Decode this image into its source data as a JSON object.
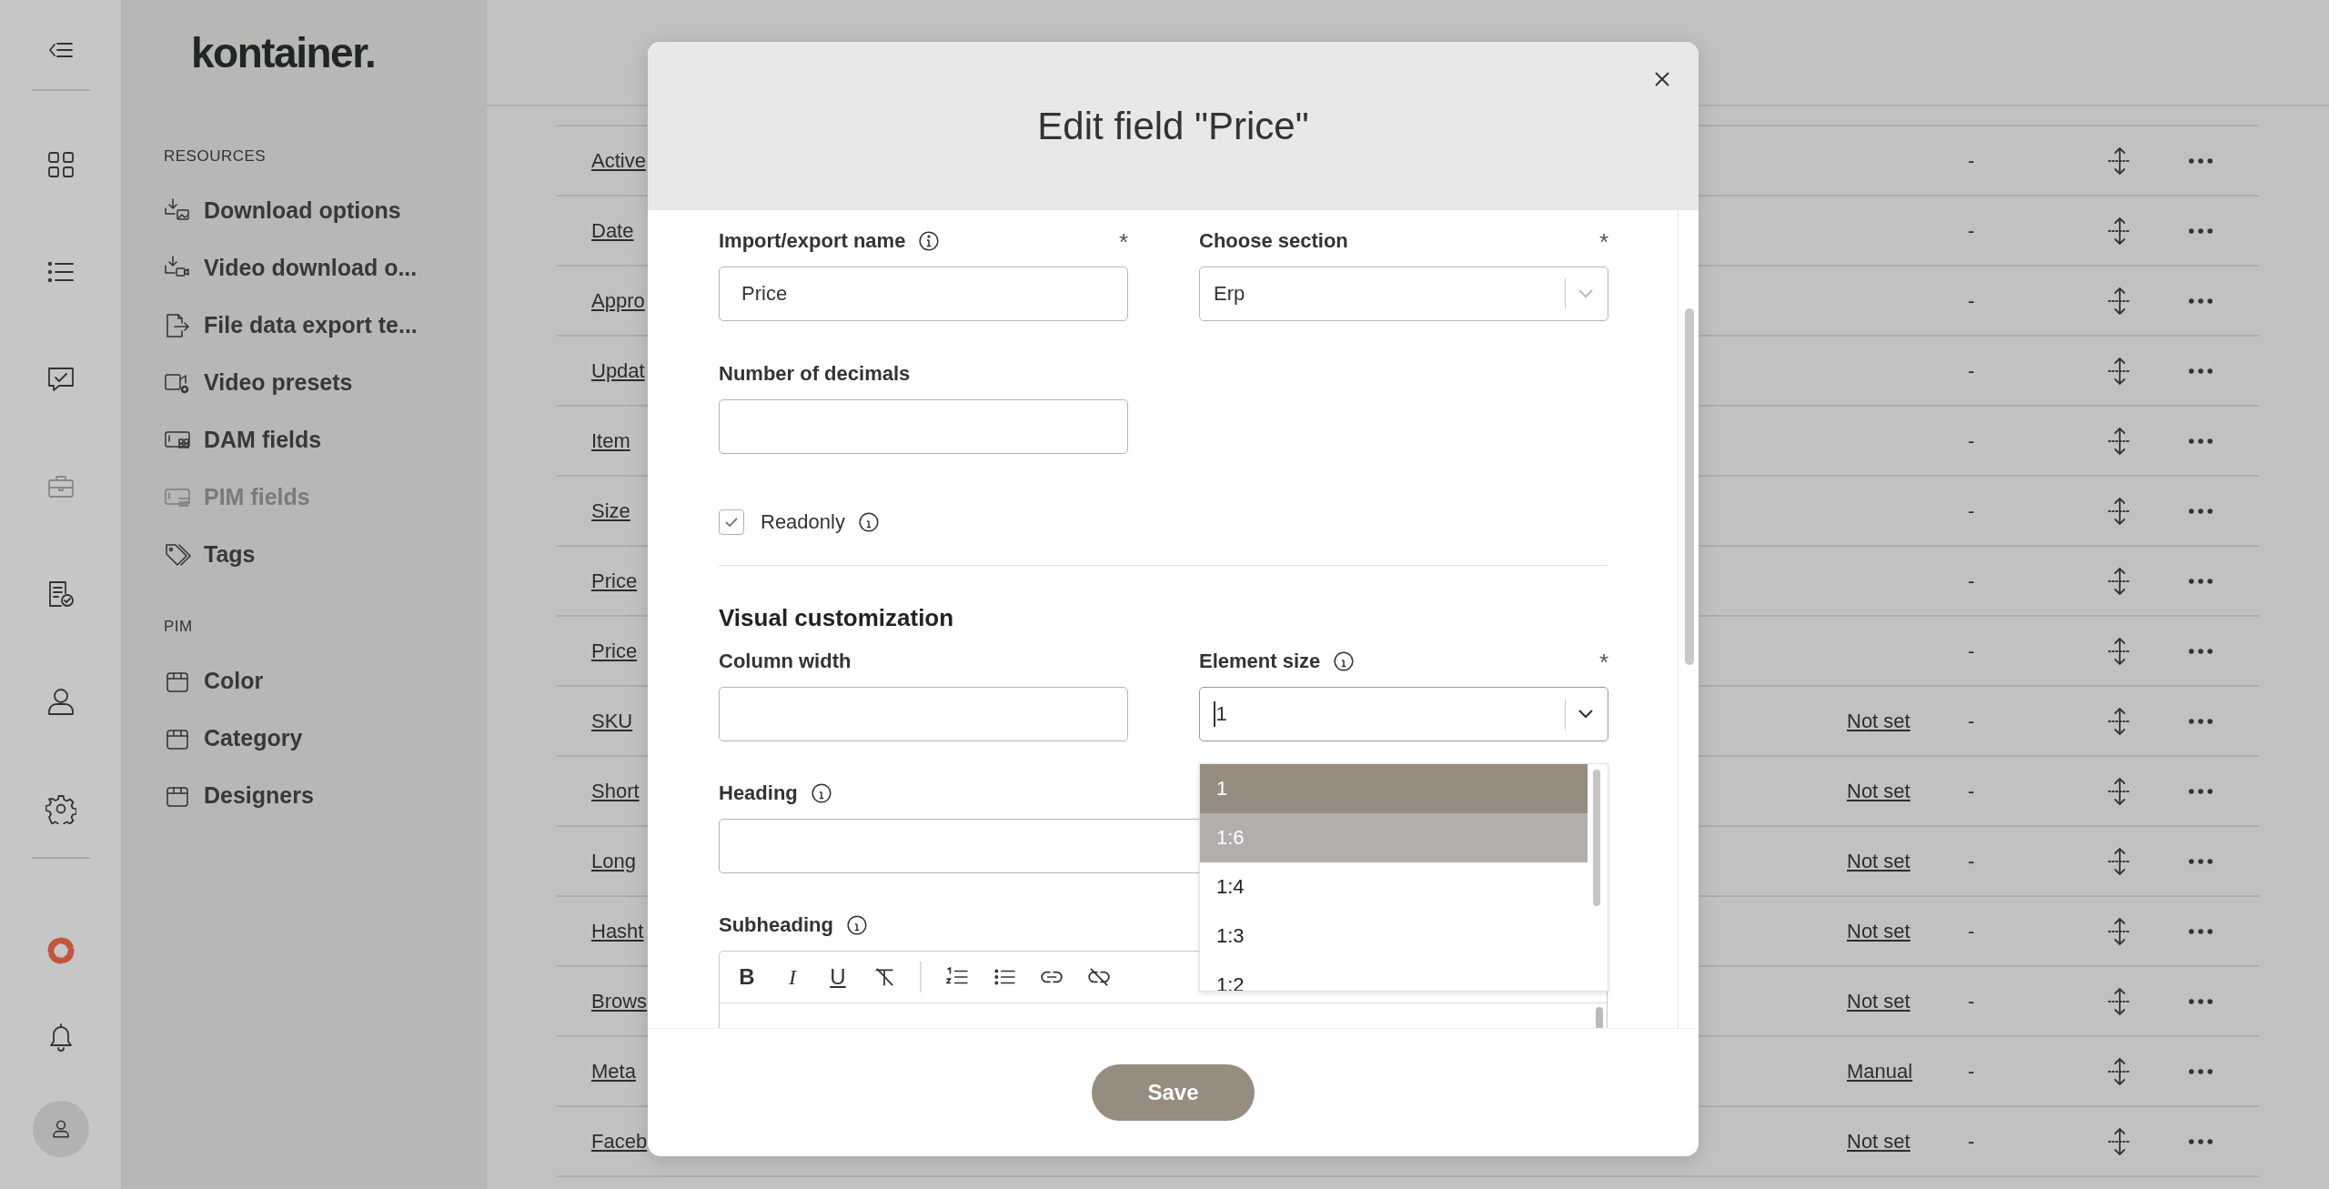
{
  "sidebar": {
    "logo": "kontainer.",
    "sections": [
      {
        "heading": "RESOURCES",
        "items": [
          {
            "label": "Download options",
            "selected": false
          },
          {
            "label": "Video download o...",
            "selected": false
          },
          {
            "label": "File data export te...",
            "selected": false
          },
          {
            "label": "Video presets",
            "selected": false
          },
          {
            "label": "DAM fields",
            "selected": false
          },
          {
            "label": "PIM fields",
            "selected": true
          },
          {
            "label": "Tags",
            "selected": false
          }
        ]
      },
      {
        "heading": "PIM",
        "items": [
          {
            "label": "Color",
            "selected": false
          },
          {
            "label": "Category",
            "selected": false
          },
          {
            "label": "Designers",
            "selected": false
          }
        ]
      }
    ]
  },
  "table": {
    "rows": [
      {
        "name": "Active",
        "column_3": "-"
      },
      {
        "name": "Date",
        "column_3": "-"
      },
      {
        "name": "Appro",
        "column_3": "-"
      },
      {
        "name": "Updat",
        "column_3": "-"
      },
      {
        "name": "Item",
        "column_3": "-"
      },
      {
        "name": "Size",
        "column_3": "-"
      },
      {
        "name": "Price",
        "column_3": "-"
      },
      {
        "name": "Price",
        "column_3": "-"
      },
      {
        "name": "SKU",
        "column_2": "Not set",
        "column_3": "-"
      },
      {
        "name": "Short",
        "column_2": "Not set",
        "column_3": "-"
      },
      {
        "name": "Long",
        "column_2": "Not set",
        "column_3": "-"
      },
      {
        "name": "Hasht",
        "column_2": "Not set",
        "column_3": "-"
      },
      {
        "name": "Brows",
        "column_2": "Not set",
        "column_3": "-"
      },
      {
        "name": "Meta",
        "column_2": "Manual",
        "column_3": "-"
      },
      {
        "name": "Faceb",
        "column_2": "Not set",
        "column_3": "-"
      }
    ]
  },
  "modal": {
    "title": "Edit field \"Price\"",
    "import_name": {
      "label": "Import/export name",
      "info": true,
      "required_mark": "*",
      "value": "Price"
    },
    "section": {
      "label": "Choose section",
      "info": false,
      "required_mark": "*",
      "value": "Erp"
    },
    "decimals": {
      "label": "Number of decimals"
    },
    "readonly": {
      "label": "Readonly",
      "checked": true,
      "info": true
    },
    "visual_heading": "Visual customization",
    "column_width": {
      "label": "Column width"
    },
    "element_size": {
      "label": "Element size",
      "info": true,
      "required_mark": "*",
      "value": "1",
      "open": true,
      "options": [
        {
          "label": "1",
          "selected": true,
          "highlighted": false
        },
        {
          "label": "1:6",
          "selected": false,
          "highlighted": true
        },
        {
          "label": "1:4",
          "selected": false,
          "highlighted": false
        },
        {
          "label": "1:3",
          "selected": false,
          "highlighted": false
        },
        {
          "label": "1:2",
          "selected": false,
          "highlighted": false
        }
      ]
    },
    "heading": {
      "label": "Heading",
      "info": true
    },
    "subheading": {
      "label": "Subheading",
      "info": true,
      "toolbar": [
        {
          "kind": "bold",
          "glyph": "B"
        },
        {
          "kind": "italic",
          "glyph": "I"
        },
        {
          "kind": "underline",
          "glyph": "U"
        },
        {
          "kind": "clear"
        },
        {
          "kind": "ordered"
        },
        {
          "kind": "bullets"
        },
        {
          "kind": "link"
        },
        {
          "kind": "unlink"
        }
      ]
    },
    "save": "Save"
  }
}
